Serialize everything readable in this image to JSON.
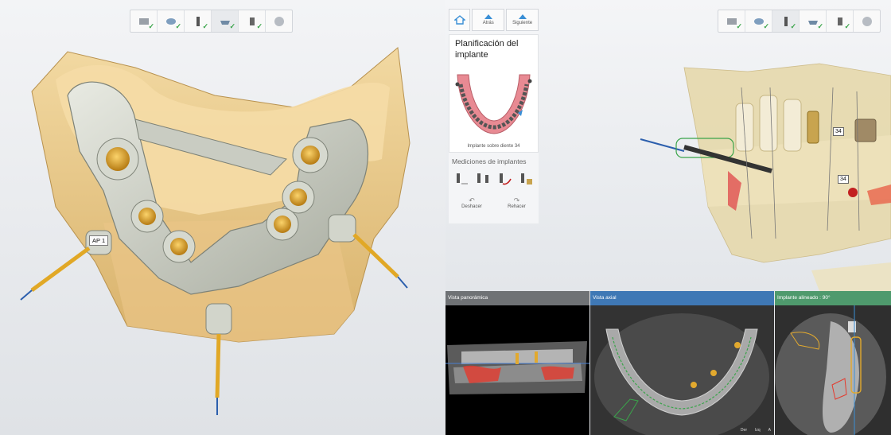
{
  "left_viewport": {
    "label_ap1": "AP 1"
  },
  "toolbar": {
    "tools": [
      {
        "icon": "scan-tool-icon",
        "done": true
      },
      {
        "icon": "model-tool-icon",
        "done": true
      },
      {
        "icon": "implant-tool-icon",
        "done": true
      },
      {
        "icon": "guide-tool-icon",
        "done": true
      },
      {
        "icon": "drill-tool-icon",
        "done": true
      },
      {
        "icon": "globe-tool-icon",
        "done": false
      }
    ],
    "check": "✓"
  },
  "nav": {
    "back_label": "Atrás",
    "next_label": "Siguiente"
  },
  "panel": {
    "title": "Planificación del implante",
    "caption": "Implante sobre diente 34",
    "measurements_title": "Mediciones de implantes",
    "undo_label": "Deshacer",
    "redo_label": "Rehacer"
  },
  "right_viewport": {
    "tooth_label": "34"
  },
  "views": {
    "panoramic": {
      "title": "Vista panorámica",
      "header_color": "#6f7275"
    },
    "axial": {
      "title": "Vista axial",
      "header_color": "#3f78b5"
    },
    "aligned": {
      "title": "Implante alineado : 90°",
      "header_color": "#4f9a6d",
      "orientation_left": "Der",
      "orientation_right": "Izq",
      "orientation_bottom": "A"
    }
  }
}
